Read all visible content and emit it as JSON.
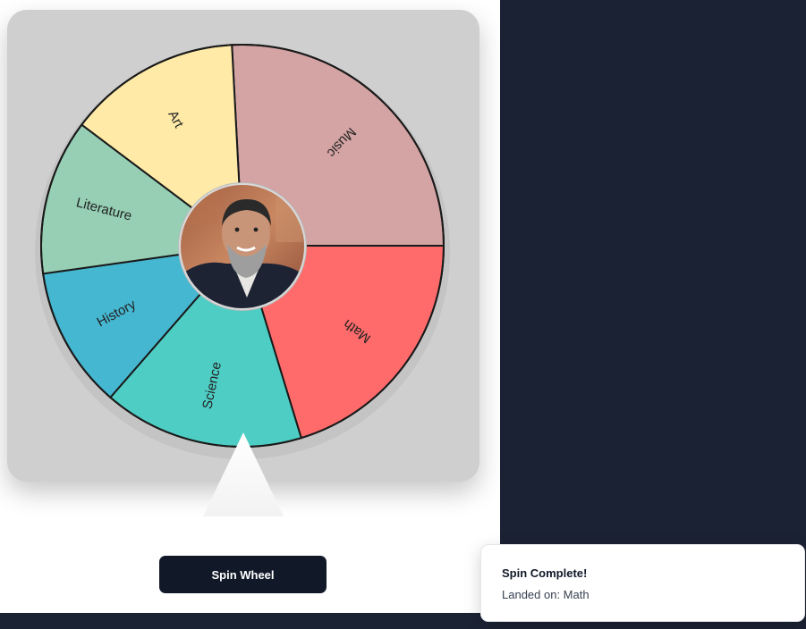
{
  "wheel": {
    "segments": [
      {
        "label": "Music",
        "color": "#d4a3a3"
      },
      {
        "label": "Math",
        "color": "#ff6b6b"
      },
      {
        "label": "Science",
        "color": "#4ecdc4"
      },
      {
        "label": "History",
        "color": "#45b7d1"
      },
      {
        "label": "Literature",
        "color": "#96cfb4"
      },
      {
        "label": "Art",
        "color": "#ffeaa7"
      }
    ],
    "center_image": "portrait-photo"
  },
  "controls": {
    "spin_label": "Spin Wheel"
  },
  "toast": {
    "title": "Spin Complete!",
    "message": "Landed on: Math"
  },
  "colors": {
    "dark_panel": "#1b2233",
    "button": "#111827",
    "card": "#cfcfcf"
  }
}
